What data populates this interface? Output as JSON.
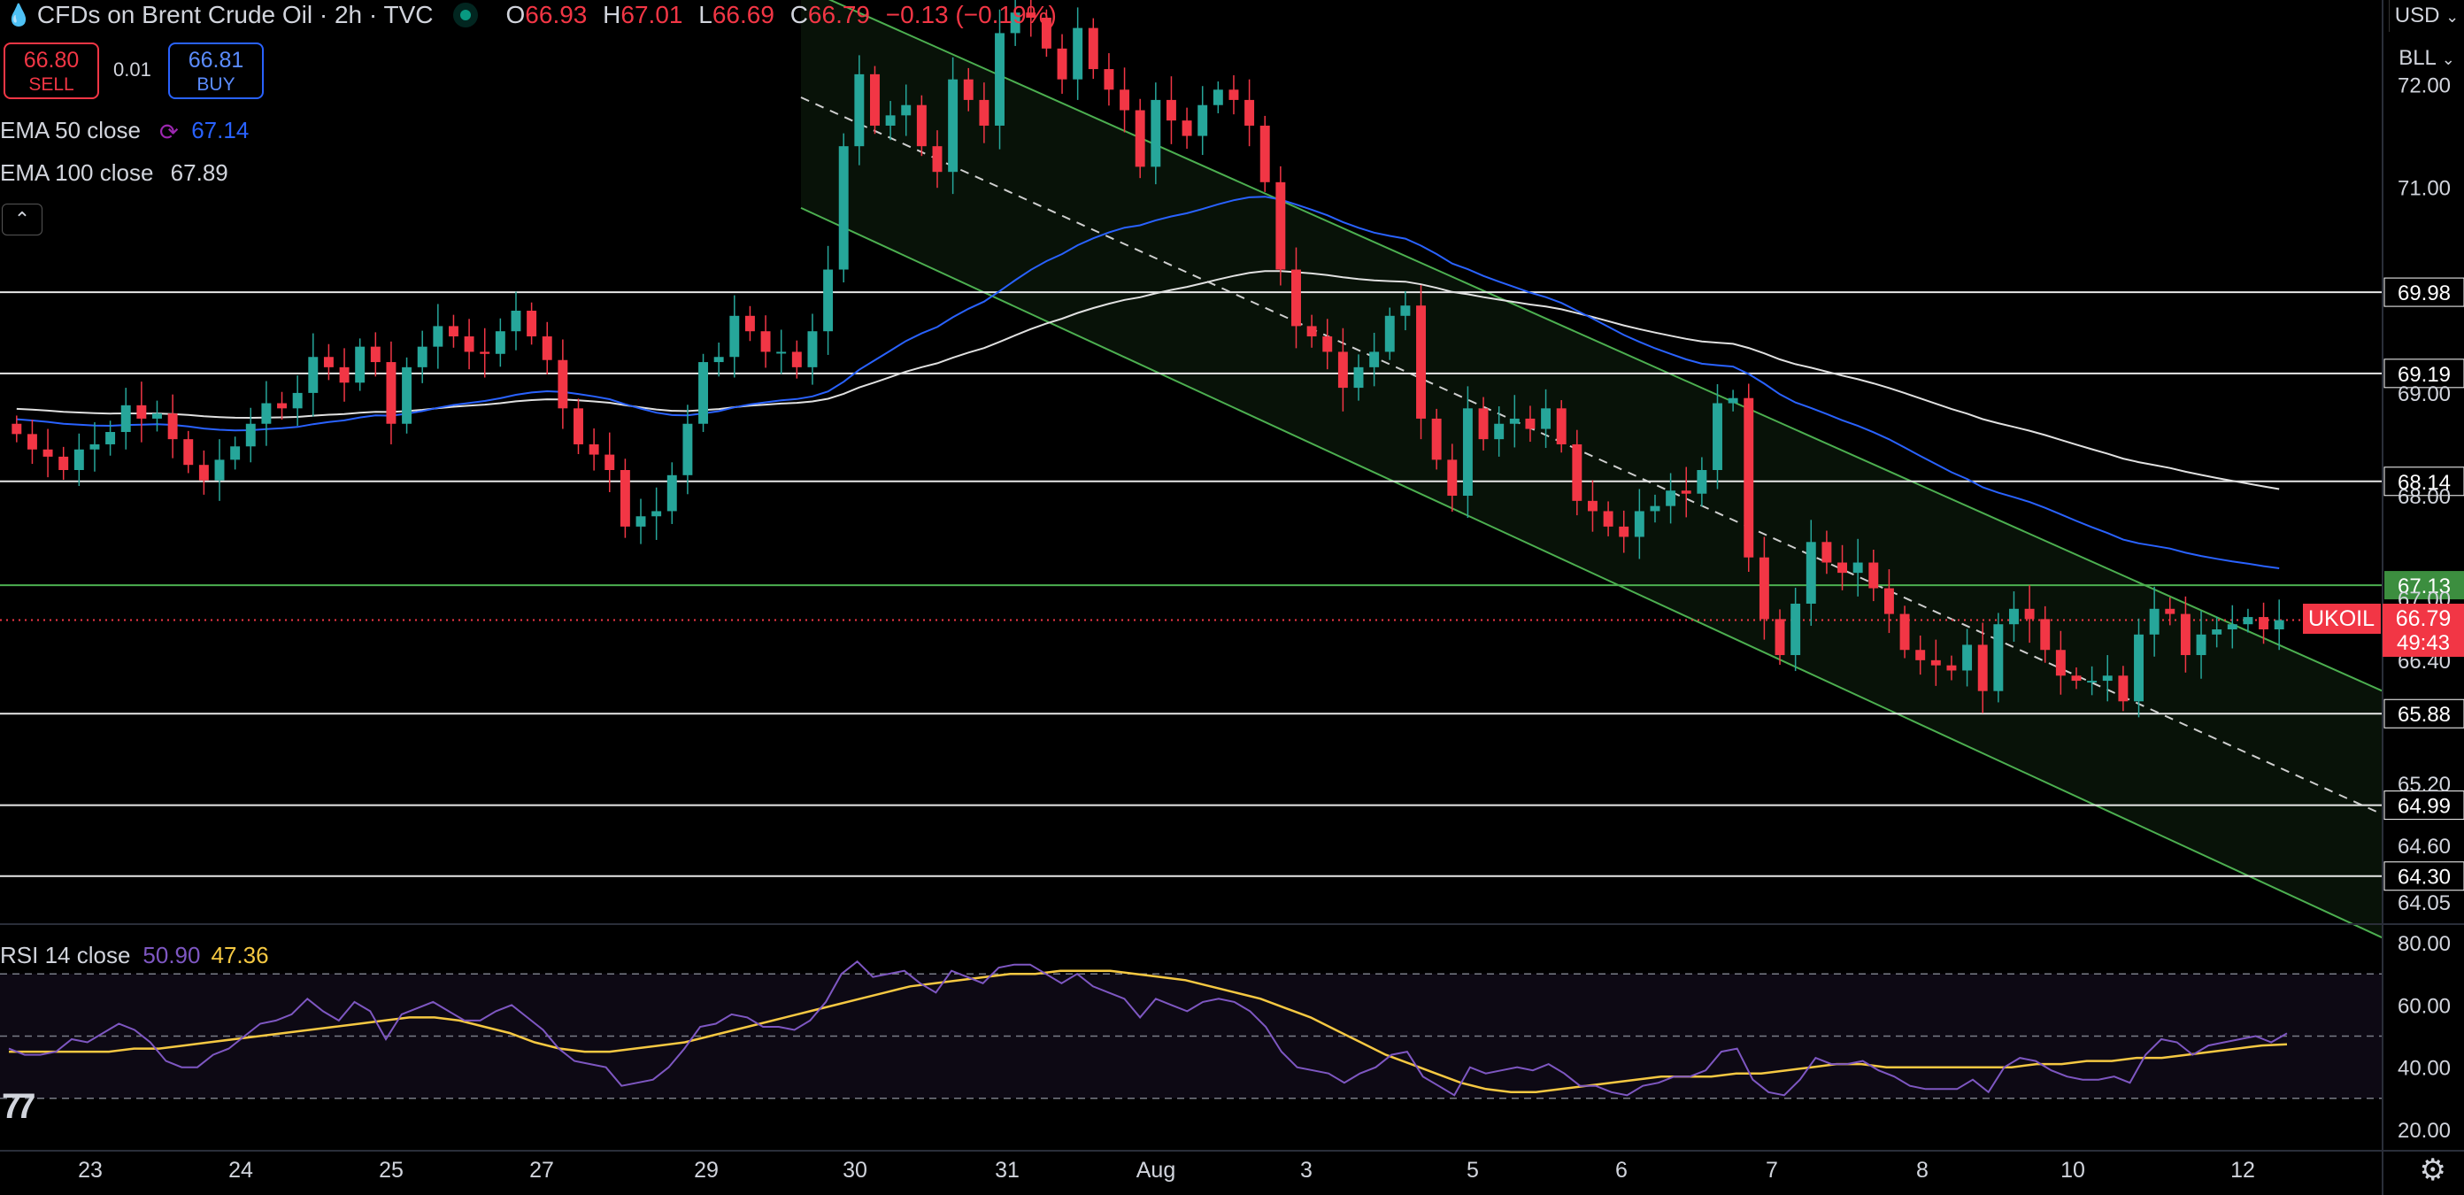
{
  "header": {
    "symbol": "CFDs on Brent Crude Oil · 2h · TVC",
    "open_k": "O",
    "open": "66.93",
    "high_k": "H",
    "high": "67.01",
    "low_k": "L",
    "low": "66.69",
    "close_k": "C",
    "close": "66.79",
    "change": "−0.13 (−0.19%)"
  },
  "trade": {
    "sell_price": "66.80",
    "sell_label": "SELL",
    "spread": "0.01",
    "buy_price": "66.81",
    "buy_label": "BUY"
  },
  "indicators": {
    "ema50_label": "EMA 50 close",
    "ema50_value": "67.14",
    "ema100_label": "EMA 100 close",
    "ema100_value": "67.89",
    "collapse_icon": "chevron-up-icon",
    "rsi_label": "RSI 14 close",
    "rsi_value": "50.90",
    "rsi_ma_value": "47.36"
  },
  "toolbar": {
    "currency": "USD",
    "account": "BLL"
  },
  "ticker_tag": "UKOIL",
  "current_price": "66.79",
  "countdown": "49:43",
  "colors": {
    "bull": "#26a69a",
    "bear": "#f23645",
    "ema50": "#2962ff",
    "ema100": "#e0e0e0",
    "rsi": "#7e57c2",
    "rsi_ma": "#f5c842",
    "channel": "#4caf50"
  },
  "chart_data": [
    {
      "type": "candlestick",
      "title": "CFDs on Brent Crude Oil · 2h · TVC",
      "x_tick_labels": [
        "23",
        "24",
        "25",
        "27",
        "29",
        "30",
        "31",
        "Aug",
        "3",
        "5",
        "6",
        "7",
        "8",
        "10",
        "12"
      ],
      "y_tick_labels": [
        "72.00",
        "71.00",
        "69.00",
        "68.00",
        "67.00",
        "66.40",
        "65.20",
        "64.60",
        "64.05"
      ],
      "y_range": [
        63.85,
        72.65
      ],
      "horizontal_levels": [
        69.98,
        69.19,
        68.14,
        67.13,
        65.88,
        64.99,
        64.3
      ],
      "level_labels": [
        "69.98",
        "69.19",
        "68.14",
        "67.13",
        "65.88",
        "64.99",
        "64.30"
      ],
      "close_prices": [
        68.6,
        68.45,
        68.38,
        68.25,
        68.45,
        68.5,
        68.62,
        68.88,
        68.75,
        68.8,
        68.55,
        68.3,
        68.15,
        68.35,
        68.48,
        68.7,
        68.9,
        68.85,
        69.0,
        69.35,
        69.25,
        69.1,
        69.45,
        69.3,
        68.7,
        69.25,
        69.45,
        69.65,
        69.55,
        69.4,
        69.38,
        69.6,
        69.8,
        69.55,
        69.32,
        68.85,
        68.5,
        68.4,
        68.25,
        67.7,
        67.8,
        67.85,
        68.2,
        68.7,
        69.3,
        69.35,
        69.75,
        69.6,
        69.4,
        69.4,
        69.25,
        69.6,
        70.2,
        71.4,
        72.1,
        71.6,
        71.7,
        71.8,
        71.4,
        71.15,
        72.05,
        71.85,
        71.6,
        72.5,
        72.7,
        72.65,
        72.35,
        72.05,
        72.55,
        72.15,
        71.95,
        71.75,
        71.2,
        71.85,
        71.65,
        71.5,
        71.8,
        71.95,
        71.85,
        71.6,
        71.05,
        70.2,
        69.65,
        69.55,
        69.4,
        69.05,
        69.25,
        69.4,
        69.75,
        69.85,
        68.75,
        68.35,
        68.0,
        68.85,
        68.55,
        68.7,
        68.75,
        68.65,
        68.85,
        68.5,
        67.95,
        67.85,
        67.7,
        67.6,
        67.85,
        67.9,
        68.05,
        68.02,
        68.25,
        68.9,
        68.95,
        67.4,
        66.8,
        66.45,
        66.95,
        67.55,
        67.35,
        67.25,
        67.35,
        67.1,
        66.85,
        66.5,
        66.4,
        66.35,
        66.3,
        66.55,
        66.1,
        66.75,
        66.9,
        66.8,
        66.5,
        66.25,
        66.2,
        66.2,
        66.25,
        66.0,
        66.65,
        66.9,
        66.85,
        66.45,
        66.65,
        66.7,
        66.75,
        66.82,
        66.7,
        66.79
      ],
      "last_price": 66.79
    },
    {
      "type": "line",
      "title": "RSI 14 close",
      "y_tick_labels": [
        "80.00",
        "60.00",
        "40.00",
        "20.00"
      ],
      "y_range": [
        16,
        86
      ],
      "band_levels": [
        70,
        50,
        30
      ],
      "series": [
        {
          "name": "RSI 14 close",
          "values": [
            46,
            44,
            44,
            45,
            49,
            48,
            51,
            54,
            52,
            48,
            42,
            40,
            40,
            44,
            46,
            50,
            54,
            55,
            57,
            62,
            58,
            55,
            61,
            58,
            49,
            57,
            59,
            61,
            58,
            55,
            55,
            58,
            60,
            56,
            52,
            46,
            42,
            41,
            40,
            34,
            35,
            36,
            40,
            46,
            53,
            54,
            57,
            56,
            53,
            53,
            52,
            55,
            61,
            70,
            74,
            69,
            70,
            71,
            67,
            64,
            71,
            69,
            67,
            72,
            73,
            73,
            70,
            67,
            70,
            66,
            64,
            62,
            56,
            62,
            60,
            58,
            61,
            62,
            61,
            58,
            53,
            45,
            40,
            39,
            38,
            35,
            38,
            40,
            44,
            45,
            37,
            34,
            31,
            40,
            38,
            39,
            40,
            39,
            41,
            38,
            34,
            34,
            32,
            31,
            34,
            35,
            37,
            37,
            39,
            45,
            46,
            36,
            32,
            31,
            36,
            43,
            41,
            41,
            42,
            39,
            37,
            34,
            33,
            33,
            33,
            36,
            32,
            40,
            43,
            42,
            39,
            37,
            36,
            36,
            37,
            35,
            44,
            49,
            48,
            44,
            47,
            48,
            49,
            50,
            48,
            50.9
          ]
        },
        {
          "name": "RSI MA",
          "values": [
            45,
            45,
            45,
            45,
            45,
            46,
            46,
            47,
            48,
            49,
            50,
            51,
            52,
            53,
            54,
            55,
            56,
            56,
            55,
            53,
            51,
            48,
            46,
            45,
            45,
            46,
            47,
            48,
            50,
            52,
            54,
            56,
            58,
            60,
            62,
            64,
            66,
            67,
            68,
            69,
            70,
            70,
            71,
            71,
            71,
            70,
            69,
            68,
            66,
            64,
            62,
            59,
            56,
            52,
            48,
            44,
            41,
            38,
            35,
            33,
            32,
            32,
            33,
            34,
            35,
            36,
            37,
            37,
            37,
            38,
            38,
            39,
            40,
            41,
            41,
            40,
            40,
            40,
            40,
            40,
            40,
            41,
            41,
            42,
            42,
            43,
            43,
            44,
            45,
            46,
            47,
            47.36
          ]
        }
      ]
    }
  ]
}
